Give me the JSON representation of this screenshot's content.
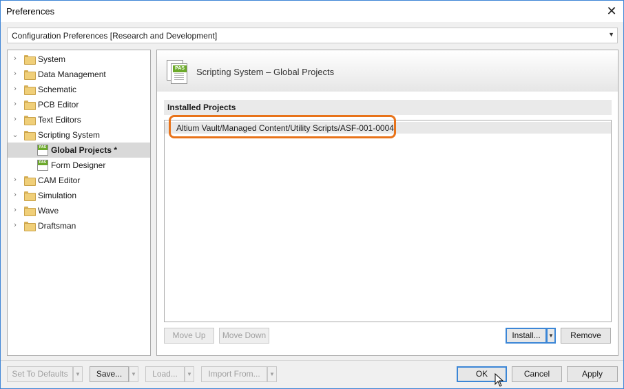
{
  "window": {
    "title": "Preferences"
  },
  "config_select": {
    "value": "Configuration Preferences [Research and Development]"
  },
  "tree": {
    "items": [
      {
        "label": "System",
        "kind": "folder",
        "expanded": false
      },
      {
        "label": "Data Management",
        "kind": "folder",
        "expanded": false
      },
      {
        "label": "Schematic",
        "kind": "folder",
        "expanded": false
      },
      {
        "label": "PCB Editor",
        "kind": "folder",
        "expanded": false
      },
      {
        "label": "Text Editors",
        "kind": "folder",
        "expanded": false
      },
      {
        "label": "Scripting System",
        "kind": "folder",
        "expanded": true
      },
      {
        "label": "Global Projects *",
        "kind": "page",
        "selected": true
      },
      {
        "label": "Form Designer",
        "kind": "page"
      },
      {
        "label": "CAM Editor",
        "kind": "folder",
        "expanded": false
      },
      {
        "label": "Simulation",
        "kind": "folder",
        "expanded": false
      },
      {
        "label": "Wave",
        "kind": "folder",
        "expanded": false
      },
      {
        "label": "Draftsman",
        "kind": "folder",
        "expanded": false
      }
    ]
  },
  "panel": {
    "icon_tag": "PAS",
    "title": "Scripting System – Global Projects",
    "section_title": "Installed Projects",
    "projects": [
      "Altium Vault/Managed Content/Utility Scripts/ASF-001-0004"
    ],
    "highlight_color": "#e8731a"
  },
  "buttons": {
    "move_up": "Move Up",
    "move_down": "Move Down",
    "install": "Install...",
    "remove": "Remove",
    "set_to_defaults": "Set To Defaults",
    "save": "Save...",
    "load": "Load...",
    "import_from": "Import From...",
    "ok": "OK",
    "cancel": "Cancel",
    "apply": "Apply"
  },
  "colors": {
    "accent": "#3b86d6",
    "folder": "#f0cf79",
    "pas_green": "#6caa2a"
  }
}
